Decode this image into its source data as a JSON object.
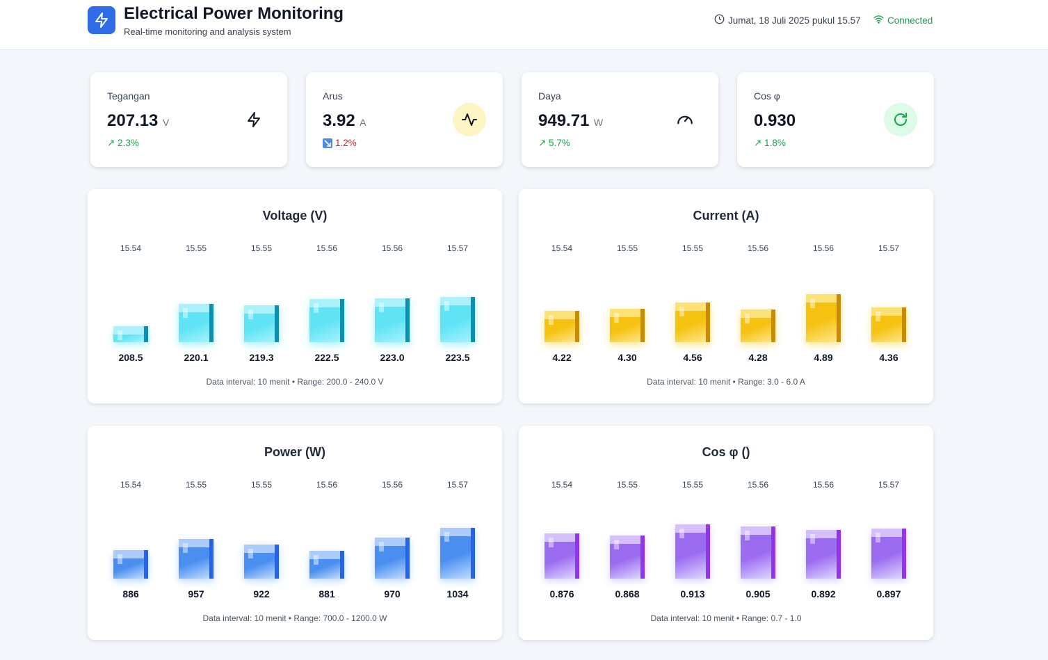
{
  "header": {
    "title": "Electrical Power Monitoring",
    "subtitle": "Real-time monitoring and analysis system",
    "datetime": "Jumat, 18 Juli 2025 pukul 15.57",
    "status": "Connected",
    "logo_icon": "lightning-icon"
  },
  "stats": [
    {
      "label": "Tegangan",
      "value": "207.13",
      "unit": "V",
      "trend": "↗ 2.3%",
      "trend_dir": "up",
      "icon": "lightning-icon",
      "icon_bg": "#ffffff"
    },
    {
      "label": "Arus",
      "value": "3.92",
      "unit": "A",
      "trend": "1.2%",
      "trend_dir": "down",
      "icon": "activity-icon",
      "icon_bg": "#fdf5c4"
    },
    {
      "label": "Daya",
      "value": "949.71",
      "unit": "W",
      "trend": "↗ 5.7%",
      "trend_dir": "up",
      "icon": "gauge-icon",
      "icon_bg": "#ffffff"
    },
    {
      "label": "Cos φ",
      "value": "0.930",
      "unit": "",
      "trend": "↗ 1.8%",
      "trend_dir": "up",
      "icon": "refresh-icon",
      "icon_bg": "#dcfce7"
    }
  ],
  "chart_data": [
    {
      "type": "bar",
      "title": "Voltage (V)",
      "categories": [
        "15.54",
        "15.55",
        "15.55",
        "15.56",
        "15.56",
        "15.57"
      ],
      "values": [
        208.5,
        220.1,
        219.3,
        222.5,
        223.0,
        223.5
      ],
      "labels": [
        "208.5",
        "220.1",
        "219.3",
        "222.5",
        "223.0",
        "223.5"
      ],
      "ylim": [
        200.0,
        240.0
      ],
      "footer": "Data interval: 10 menit • Range: 200.0 - 240.0 V",
      "colors": {
        "top": "#5fe3f5",
        "bottom": "#a5f3fc",
        "side": "#0891b2",
        "cap": "#b8f3fb"
      }
    },
    {
      "type": "bar",
      "title": "Current (A)",
      "categories": [
        "15.54",
        "15.55",
        "15.55",
        "15.56",
        "15.56",
        "15.57"
      ],
      "values": [
        4.22,
        4.3,
        4.56,
        4.28,
        4.89,
        4.36
      ],
      "labels": [
        "4.22",
        "4.30",
        "4.56",
        "4.28",
        "4.89",
        "4.36"
      ],
      "ylim": [
        3.0,
        6.0
      ],
      "footer": "Data interval: 10 menit • Range: 3.0 - 6.0 A",
      "colors": {
        "top": "#f5c211",
        "bottom": "#fde68a",
        "side": "#ca8a04",
        "cap": "#fde68a"
      }
    },
    {
      "type": "bar",
      "title": "Power (W)",
      "categories": [
        "15.54",
        "15.55",
        "15.55",
        "15.56",
        "15.56",
        "15.57"
      ],
      "values": [
        886,
        957,
        922,
        881,
        970,
        1034
      ],
      "labels": [
        "886",
        "957",
        "922",
        "881",
        "970",
        "1034"
      ],
      "ylim": [
        700.0,
        1200.0
      ],
      "footer": "Data interval: 10 menit • Range: 700.0 - 1200.0 W",
      "colors": {
        "top": "#4a8ef0",
        "bottom": "#bfdbfe",
        "side": "#2563eb",
        "cap": "#bcd6fb"
      }
    },
    {
      "type": "bar",
      "title": "Cos φ ()",
      "categories": [
        "15.54",
        "15.55",
        "15.55",
        "15.56",
        "15.56",
        "15.57"
      ],
      "values": [
        0.876,
        0.868,
        0.913,
        0.905,
        0.892,
        0.897
      ],
      "labels": [
        "0.876",
        "0.868",
        "0.913",
        "0.905",
        "0.892",
        "0.897"
      ],
      "ylim": [
        0.7,
        1.0
      ],
      "footer": "Data interval: 10 menit • Range: 0.7 - 1.0",
      "colors": {
        "top": "#9b6cf0",
        "bottom": "#ddd6fe",
        "side": "#9333ea",
        "cap": "#e0cffd"
      }
    }
  ]
}
